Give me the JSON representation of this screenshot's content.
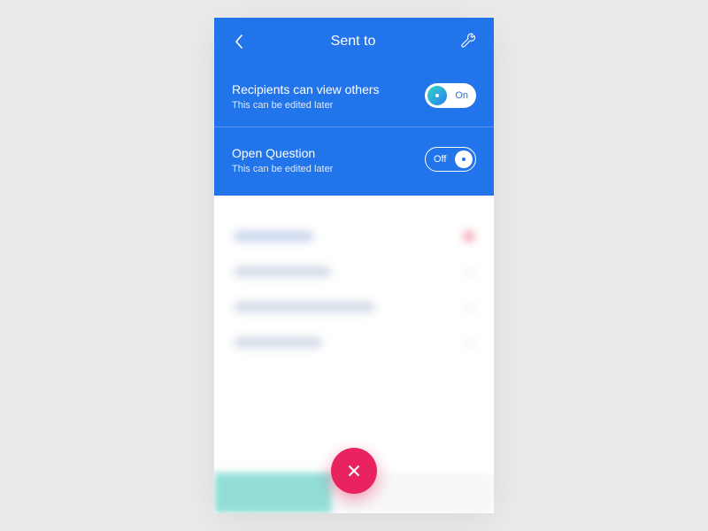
{
  "header": {
    "title": "Sent to"
  },
  "settings": [
    {
      "label": "Recipients can view others",
      "sub": "This can be edited later",
      "state": "On",
      "on": true
    },
    {
      "label": "Open Question",
      "sub": "This can be edited later",
      "state": "Off",
      "on": false
    }
  ],
  "colors": {
    "primary": "#2274ea",
    "fab": "#e8235f",
    "teal": "#2fd6c4"
  },
  "icons": {
    "back": "chevron-left-icon",
    "settings": "wrench-icon",
    "close": "close-icon"
  }
}
